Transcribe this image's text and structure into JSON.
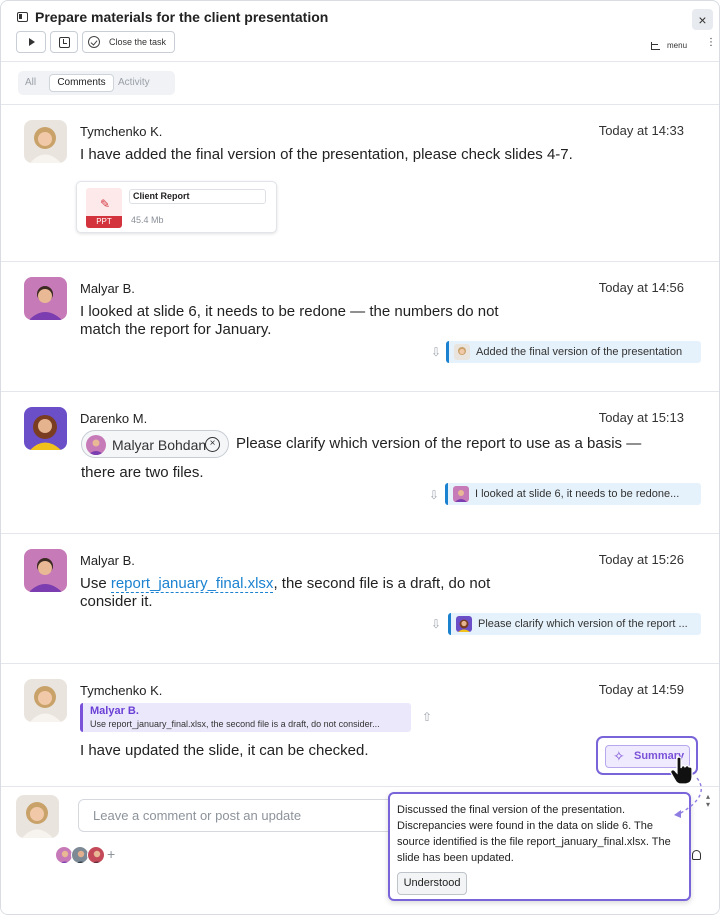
{
  "header": {
    "title": "Prepare materials for the client presentation",
    "close_task_label": "Close the task",
    "menu_label": "menu",
    "close_icon": "×",
    "more_icon": "⋮"
  },
  "tabs": [
    {
      "label": "All",
      "active": false
    },
    {
      "label": "Comments",
      "active": true
    },
    {
      "label": "Activity",
      "active": false
    }
  ],
  "comments": [
    {
      "author": "Tymchenko K.",
      "time": "Today at 14:33",
      "text": "I have added the final version of the presentation, please check slides 4-7.",
      "attachment": {
        "name": "Client Report",
        "size": "45.4 Mb",
        "type": "PPT"
      }
    },
    {
      "author": "Malyar B.",
      "time": "Today at 14:56",
      "text_line1": "I looked at slide 6, it needs to be redone — the numbers do not",
      "text_line2": "match the report for January.",
      "reply_to": "Added the final version of the presentation"
    },
    {
      "author": "Darenko M.",
      "time": "Today at 15:13",
      "mention": "Malyar Bohdan",
      "text_line1": "Please clarify which version of the report to use as a basis —",
      "text_line2": "there are two files.",
      "reply_to": "I looked at slide 6, it needs to be redone..."
    },
    {
      "author": "Malyar B.",
      "time": "Today at 15:26",
      "text_prefix": "Use ",
      "link": "report_january_final.xlsx",
      "text_suffix": ", the second file is a draft, do not",
      "text_line2": "consider it.",
      "reply_to": "Please clarify which version of the report ..."
    },
    {
      "author": "Tymchenko K.",
      "time": "Today at 14:59",
      "quote_author": "Malyar B.",
      "quote_text": "Use report_january_final.xlsx, the second file is a draft, do not consider...",
      "text": "I have updated the slide, it can be checked.",
      "summary_label": "Summary"
    }
  ],
  "composer": {
    "placeholder": "Leave a comment or post an update",
    "add_follower": "+"
  },
  "summary_popover": {
    "text": "Discussed the final version of the presentation. Discrepancies were found in the data on slide 6. The source identified is the file report_january_final.xlsx. The slide has been updated.",
    "button": "Understood"
  },
  "colors": {
    "accent_purple": "#7a64d9",
    "reply_blue": "#1b82d0",
    "ppt_red": "#d3333d"
  }
}
